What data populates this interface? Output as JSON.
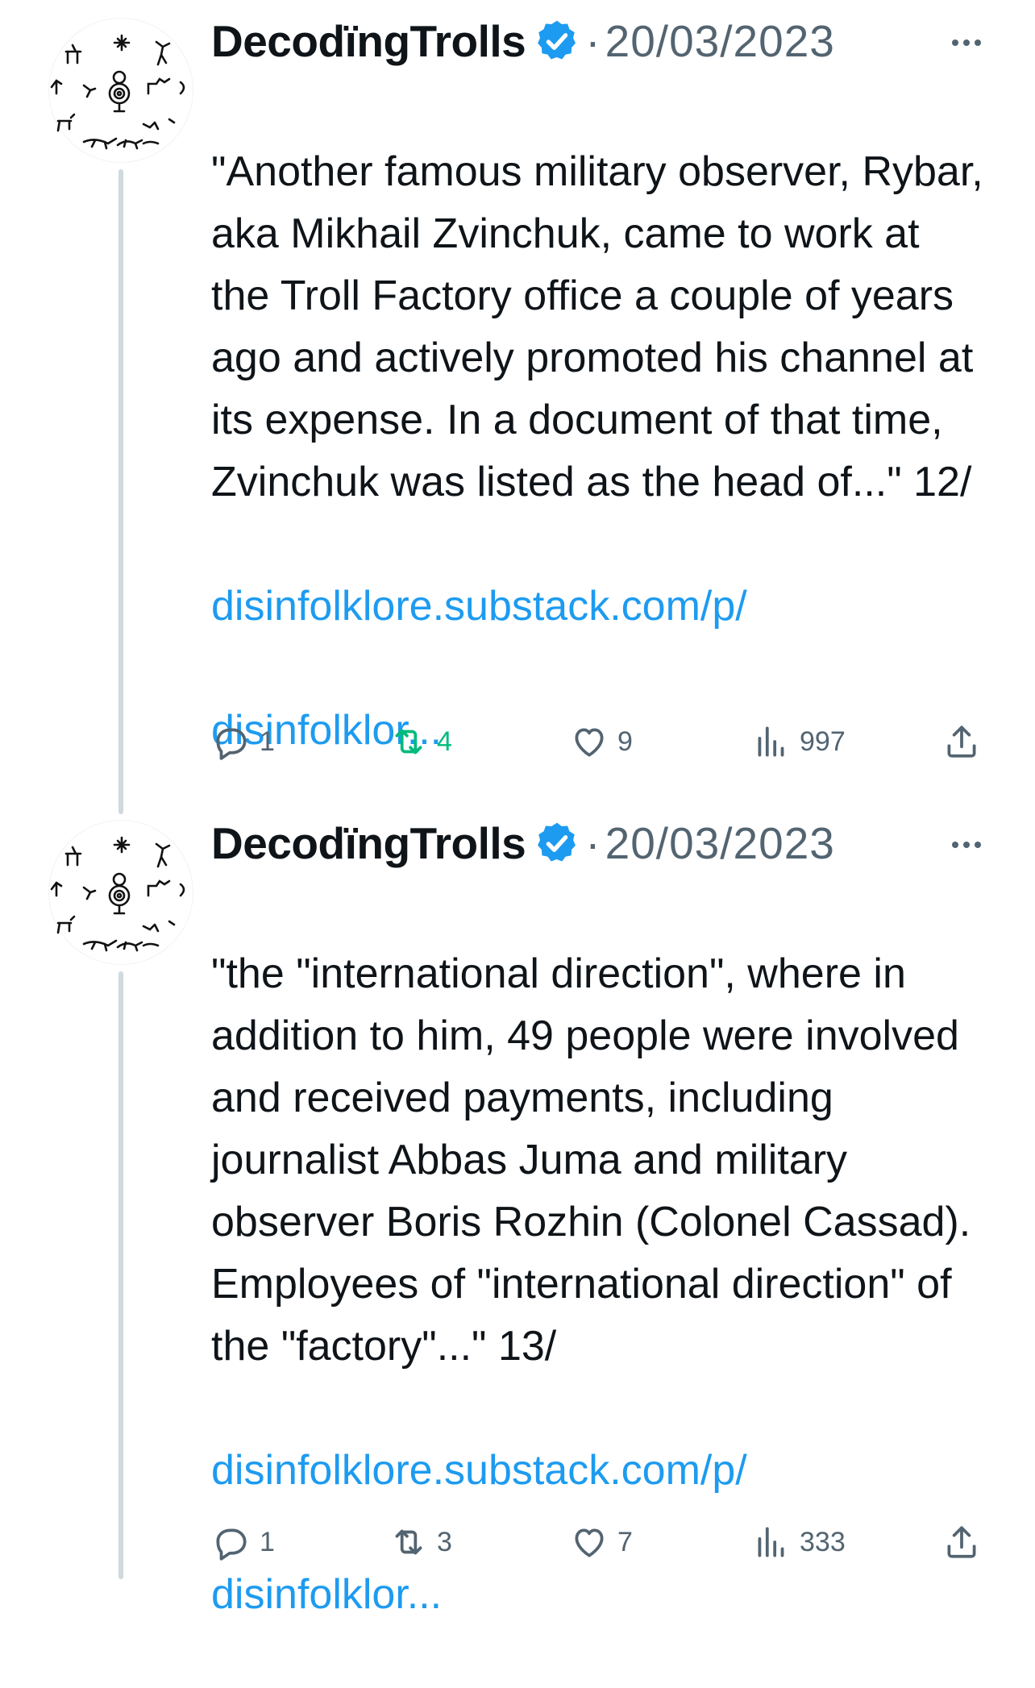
{
  "tweets": [
    {
      "author": "DecodïngTrolls",
      "separator": "·",
      "date": "20/03/2023",
      "text": "\"Another famous military observer, Rybar, aka Mikhail Zvinchuk, came to work at the Troll Factory office a couple of years ago and actively promoted his channel at its expense. In a document of that time, Zvinchuk was listed as the head of...\" 12/",
      "link_line1": "disinfolklore.substack.com/p/",
      "link_line2": "disinfolklor...",
      "replies": "1",
      "retweets": "4",
      "retweeted": true,
      "likes": "9",
      "views": "997"
    },
    {
      "author": "DecodïngTrolls",
      "separator": "·",
      "date": "20/03/2023",
      "text": "\"the \"international direction\", where in addition to him, 49 people were involved and received payments, including journalist Abbas Juma and military observer Boris Rozhin (Colonel Cassad). Employees of \"international direction\" of the \"factory\"...\" 13/",
      "link_line1": "disinfolklore.substack.com/p/",
      "link_line2": "disinfolklor...",
      "replies": "1",
      "retweets": "3",
      "retweeted": false,
      "likes": "7",
      "views": "333"
    }
  ],
  "colors": {
    "link": "#1d9bf0",
    "secondary": "#536471",
    "verified": "#1d9bf0",
    "retweet_active": "#00ba7c",
    "thread_line": "#cfd9de"
  },
  "icons": [
    "verified-badge-icon",
    "more-icon",
    "reply-icon",
    "retweet-icon",
    "like-icon",
    "views-icon",
    "share-icon"
  ]
}
